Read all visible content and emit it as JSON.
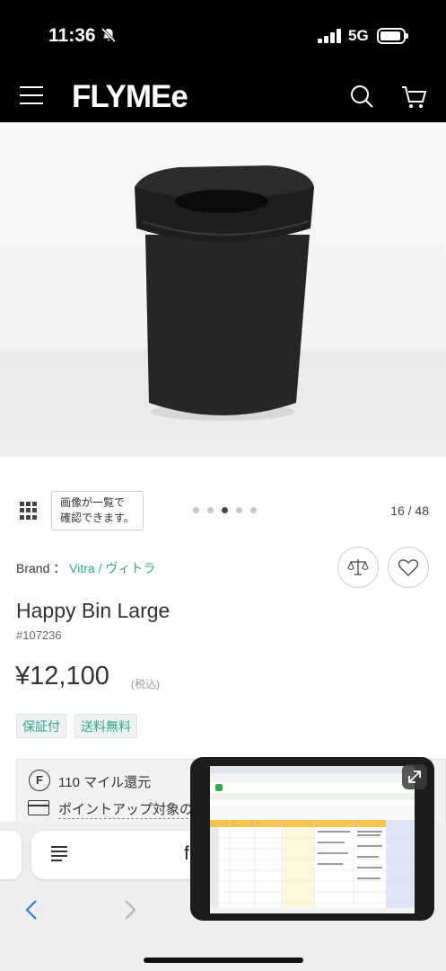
{
  "status_bar": {
    "time": "11:36",
    "network": "5G"
  },
  "header": {
    "logo": "FLYMEe"
  },
  "gallery": {
    "tooltip_line1": "画像が一覧で",
    "tooltip_line2": "確認できます。",
    "counter": "16 / 48",
    "dots_total": 5,
    "active_dot": 3
  },
  "product": {
    "brand_label": "Brand",
    "brand_sep": "：",
    "brand_name": "Vitra / ヴィトラ",
    "name": "Happy Bin Large",
    "code": "#107236",
    "price": "¥12,100",
    "tax_note": "(税込)",
    "badges": [
      "保証付",
      "送料無料"
    ],
    "miles_text": "110 マイル還元",
    "point_up_text": "ポイントアップ対象の",
    "f_icon_letter": "F"
  },
  "browser": {
    "address_visible_text": "f"
  },
  "colors": {
    "accent_green": "#2aa88a",
    "header_bg": "#000000"
  },
  "icons": [
    "bell-slash-icon",
    "signal-icon",
    "battery-icon",
    "menu-icon",
    "search-icon",
    "cart-icon",
    "grid-icon",
    "compare-scale-icon",
    "heart-icon",
    "f-circle-icon",
    "card-icon",
    "reader-icon",
    "back-chevron-icon",
    "forward-chevron-icon",
    "expand-icon"
  ]
}
